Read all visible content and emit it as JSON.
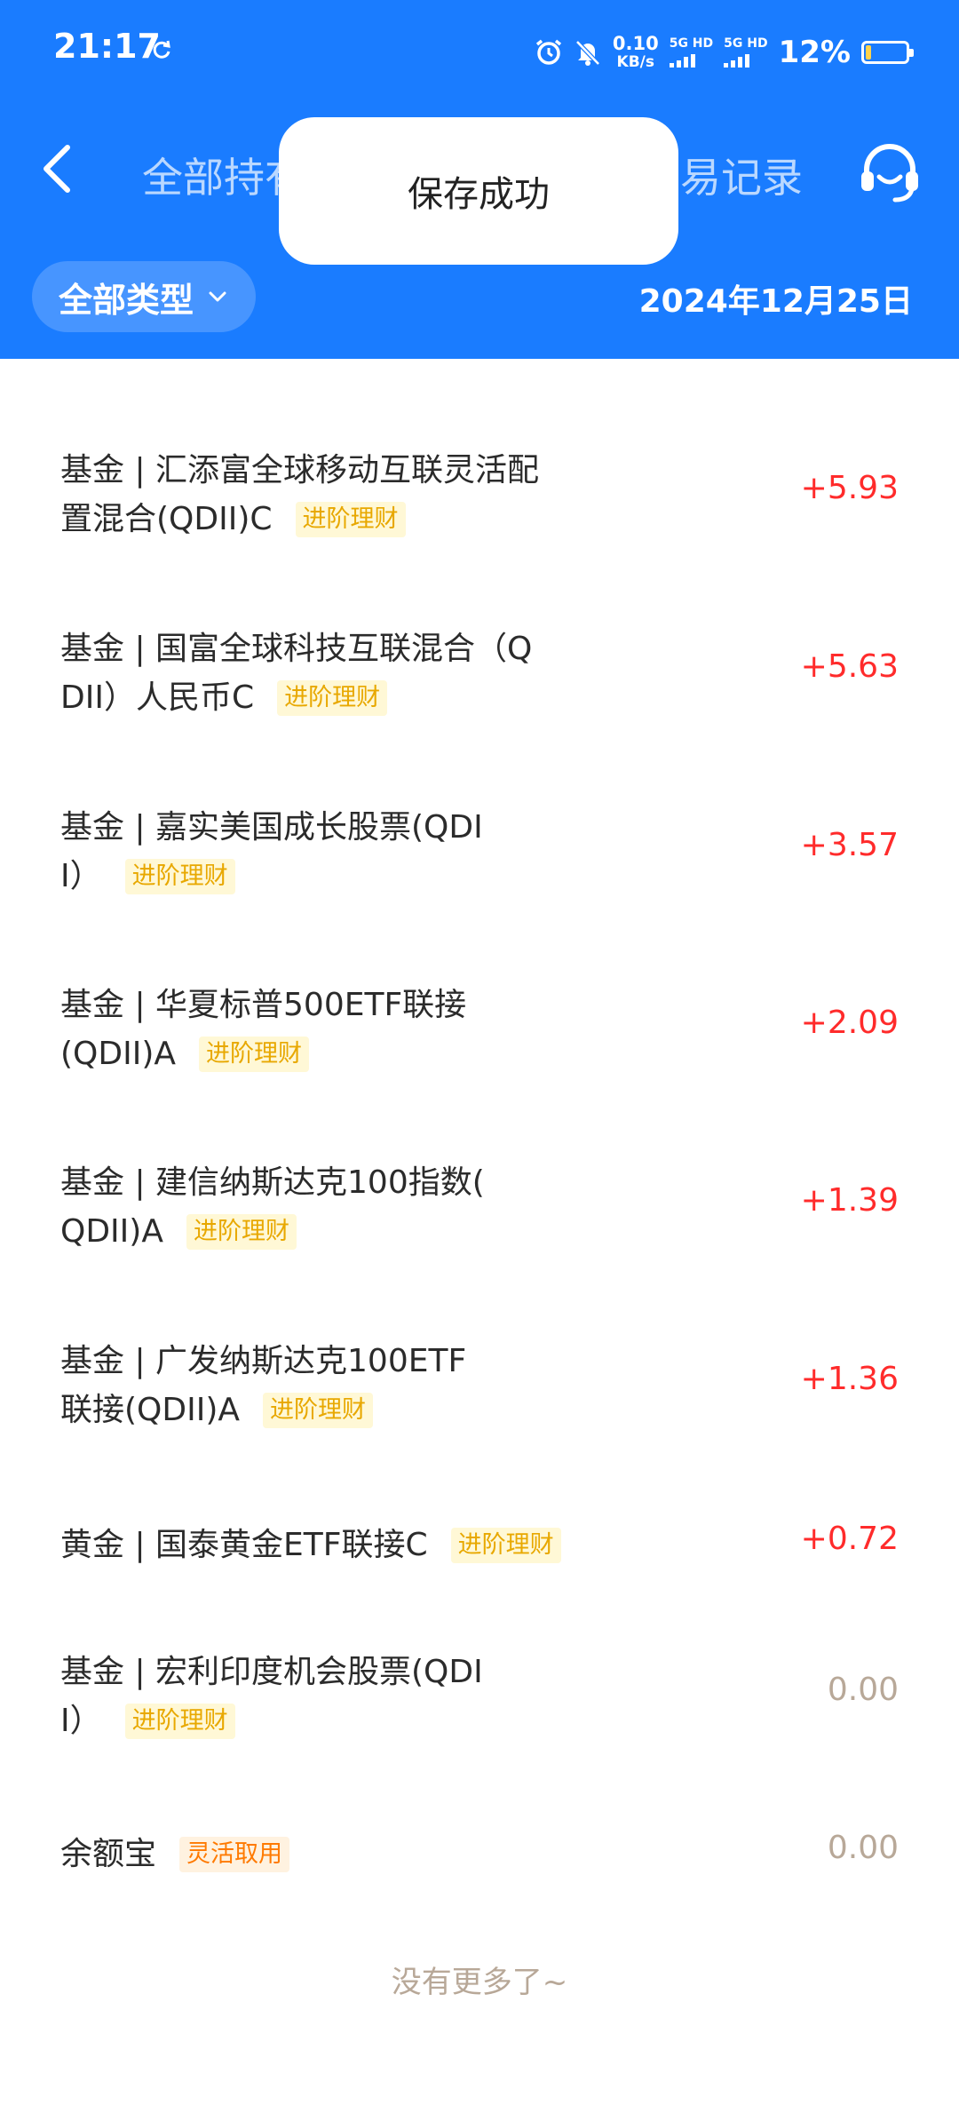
{
  "status_bar": {
    "time": "21:17",
    "net_speed_value": "0.10",
    "net_speed_unit": "KB/s",
    "sim1_label": "5G HD",
    "sim2_label": "5G HD",
    "battery_percent": "12%",
    "battery_level": 0.12,
    "icons": [
      "sync-icon",
      "alarm-icon",
      "mute-icon",
      "signal-icon",
      "battery-icon"
    ]
  },
  "nav": {
    "tab_all_holdings": "全部持有",
    "tab_records": "交易记录"
  },
  "toast": {
    "message": "保存成功"
  },
  "filter": {
    "type_label": "全部类型",
    "date": "2024年12月25日"
  },
  "holdings": [
    {
      "line1": "基金 | 汇添富全球移动互联灵活配",
      "line2": "置混合(QDII)C",
      "tag": "进阶理财",
      "value": "+5.93"
    },
    {
      "line1": "基金 | 国富全球科技互联混合（Q",
      "line2": "DII）人民币C",
      "tag": "进阶理财",
      "value": "+5.63"
    },
    {
      "line1": "基金 | 嘉实美国成长股票(QDI",
      "line2": "I）",
      "tag": "进阶理财",
      "value": "+3.57"
    },
    {
      "line1": "基金 | 华夏标普500ETF联接",
      "line2": "(QDII)A",
      "tag": "进阶理财",
      "value": "+2.09"
    },
    {
      "line1": "基金 | 建信纳斯达克100指数(",
      "line2": "QDII)A",
      "tag": "进阶理财",
      "value": "+1.39"
    },
    {
      "line1": "基金 | 广发纳斯达克100ETF",
      "line2": "联接(QDII)A",
      "tag": "进阶理财",
      "value": "+1.36"
    },
    {
      "line1": "黄金 | 国泰黄金ETF联接C",
      "tag": "进阶理财",
      "value": "+0.72"
    },
    {
      "line1": "基金 | 宏利印度机会股票(QDI",
      "line2": "I）",
      "tag": "进阶理财",
      "value": "0.00"
    },
    {
      "line1": "余额宝",
      "tag": "灵活取用",
      "value": "0.00"
    }
  ],
  "footer": {
    "no_more": "没有更多了~"
  },
  "colors": {
    "header_blue": "#1a7cff",
    "positive_red": "#ff2b2b",
    "zero_gray": "#b8a898",
    "tag_yellow": "#e8a800",
    "tag_orange": "#ff7a00"
  }
}
